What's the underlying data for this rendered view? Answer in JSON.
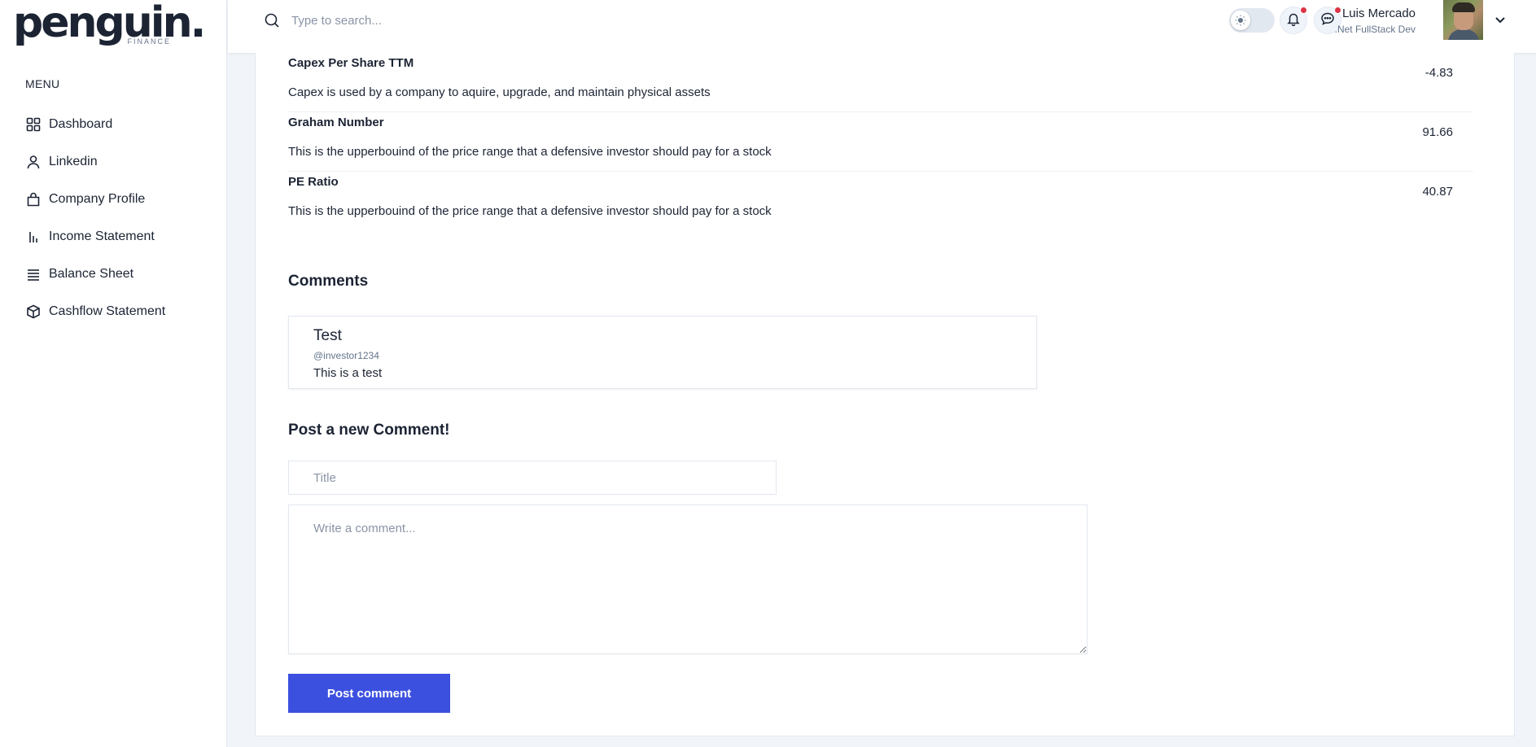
{
  "brand": {
    "name": "penguin.",
    "subtitle": "FINANCE"
  },
  "sidebar": {
    "menu_title": "MENU",
    "items": [
      {
        "label": "Dashboard",
        "icon": "grid-icon"
      },
      {
        "label": "Linkedin",
        "icon": "user-icon"
      },
      {
        "label": "Company Profile",
        "icon": "bag-icon"
      },
      {
        "label": "Income Statement",
        "icon": "bar-chart-icon"
      },
      {
        "label": "Balance Sheet",
        "icon": "list-icon"
      },
      {
        "label": "Cashflow Statement",
        "icon": "cube-icon"
      }
    ]
  },
  "header": {
    "search_placeholder": "Type to search...",
    "user": {
      "name": "Luis Mercado",
      "role": ".Net FullStack Dev"
    }
  },
  "metrics": [
    {
      "title": "Capex Per Share TTM",
      "description": "Capex is used by a company to aquire, upgrade, and maintain physical assets",
      "value": "-4.83"
    },
    {
      "title": "Graham Number",
      "description": "This is the upperbouind of the price range that a defensive investor should pay for a stock",
      "value": "91.66"
    },
    {
      "title": "PE Ratio",
      "description": "This is the upperbouind of the price range that a defensive investor should pay for a stock",
      "value": "40.87"
    }
  ],
  "comments": {
    "heading": "Comments",
    "items": [
      {
        "title": "Test",
        "handle": "@investor1234",
        "text": "This is a test"
      }
    ]
  },
  "new_comment": {
    "heading": "Post a new Comment!",
    "title_placeholder": "Title",
    "body_placeholder": "Write a comment...",
    "submit_label": "Post comment"
  },
  "colors": {
    "accent": "#3c50e0",
    "notification_dot": "#dc3545",
    "text": "#1c2434"
  }
}
